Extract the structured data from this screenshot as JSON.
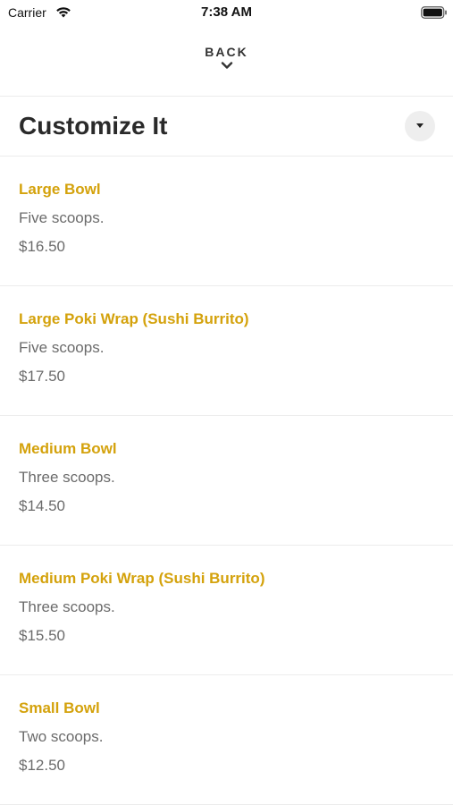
{
  "status_bar": {
    "carrier": "Carrier",
    "time": "7:38 AM",
    "icons": [
      "wifi-icon",
      "battery-icon"
    ]
  },
  "nav": {
    "back_label": "BACK",
    "back_icon": "chevron-down-icon"
  },
  "section": {
    "title": "Customize It",
    "toggle_icon": "caret-down-icon"
  },
  "colors": {
    "accent": "#d4a20c",
    "text_primary": "#2a2a2a",
    "text_secondary": "#6b6b6b",
    "divider": "#ececec"
  },
  "options": [
    {
      "name": "Large Bowl",
      "description": "Five scoops.",
      "price": "$16.50"
    },
    {
      "name": "Large Poki Wrap (Sushi Burrito)",
      "description": "Five scoops.",
      "price": "$17.50"
    },
    {
      "name": "Medium Bowl",
      "description": "Three scoops.",
      "price": "$14.50"
    },
    {
      "name": "Medium Poki Wrap (Sushi Burrito)",
      "description": "Three scoops.",
      "price": "$15.50"
    },
    {
      "name": "Small Bowl",
      "description": "Two scoops.",
      "price": "$12.50"
    }
  ]
}
